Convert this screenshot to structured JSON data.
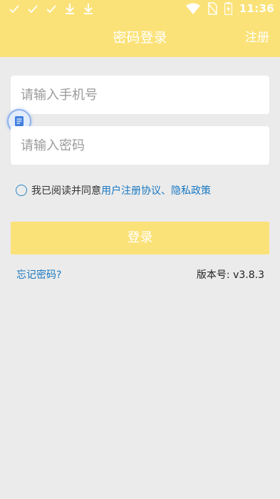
{
  "status_bar": {
    "time": "11:36",
    "left_icons": [
      "check-icon",
      "check-icon",
      "check-icon",
      "download-icon",
      "download-icon"
    ],
    "right_icons": [
      "wifi-icon",
      "no-sim-icon",
      "battery-charging-icon"
    ]
  },
  "header": {
    "title": "密码登录",
    "register_label": "注册"
  },
  "form": {
    "phone_placeholder": "请输入手机号",
    "password_placeholder": "请输入密码",
    "agreement": {
      "prefix": "我已阅读并同意",
      "user_agreement": "用户注册协议",
      "separator": "、",
      "privacy_policy": "隐私政策"
    },
    "login_label": "登录",
    "forgot_label": "忘记密码?",
    "version_label": "版本号: v3.8.3"
  },
  "colors": {
    "accent": "#fbe278",
    "link": "#1a78c2",
    "background": "#ebebeb"
  }
}
